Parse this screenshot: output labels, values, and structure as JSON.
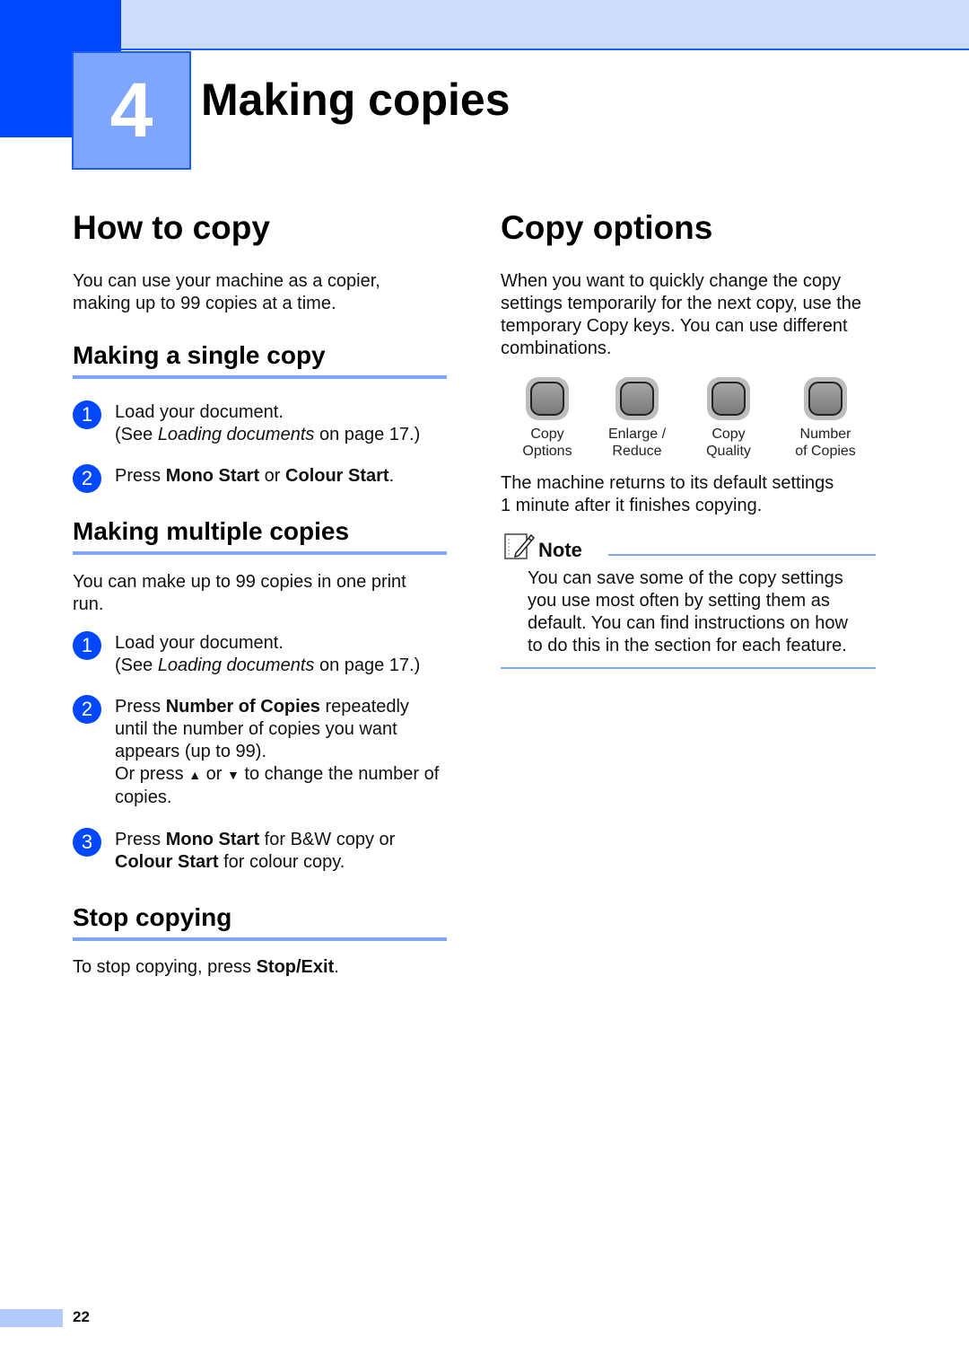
{
  "chapter": {
    "number": "4",
    "title": "Making copies"
  },
  "how_to_copy": {
    "heading": "How to copy",
    "intro": [
      "You can use your machine as a copier,",
      "making up to 99 copies at a time."
    ]
  },
  "single_copy": {
    "heading": "Making a single copy",
    "steps": [
      {
        "num": "1",
        "l1": "Load your document.",
        "l2_pre": "(See ",
        "l2_italic": "Loading documents",
        "l2_post": " on page 17.)"
      },
      {
        "num": "2",
        "pre": "Press ",
        "b1": "Mono Start",
        "mid": " or ",
        "b2": "Colour Start",
        "post": "."
      }
    ]
  },
  "multiple_copies": {
    "heading": "Making multiple copies",
    "intro": [
      "You can make up to 99 copies in one print",
      "run."
    ],
    "steps": [
      {
        "num": "1",
        "l1": "Load your document.",
        "l2_pre": "(See ",
        "l2_italic": "Loading documents",
        "l2_post": " on page 17.)"
      },
      {
        "num": "2",
        "pre": "Press ",
        "b1": "Number of Copies",
        "post": " repeatedly",
        "l2": "until the number of copies you want",
        "l3": "appears (up to 99).",
        "l4_pre": "Or press ",
        "up": "▲",
        "l4_mid": " or ",
        "down": "▼",
        "l4_post": " to change the number of",
        "l5": "copies."
      },
      {
        "num": "3",
        "pre": "Press ",
        "b1": "Mono Start",
        "post": " for B&W copy or",
        "b2": "Colour Start",
        "post2": " for colour copy."
      }
    ]
  },
  "stop_copying": {
    "heading": "Stop copying",
    "pre": "To stop copying, press ",
    "bold": "Stop/Exit",
    "post": "."
  },
  "copy_options": {
    "heading": "Copy options",
    "intro": [
      "When you want to quickly change the copy",
      "settings temporarily for the next copy, use the",
      "temporary Copy keys. You can use different",
      "combinations."
    ],
    "keys": [
      {
        "l1": "Copy",
        "l2": "Options"
      },
      {
        "l1": "Enlarge /",
        "l2": "Reduce"
      },
      {
        "l1": "Copy",
        "l2": "Quality"
      },
      {
        "l1": "Number",
        "l2": "of Copies"
      }
    ],
    "after": [
      "The machine returns to its default settings",
      "1 minute after it finishes copying."
    ]
  },
  "note": {
    "title": "Note",
    "lines": [
      "You can save some of the copy settings",
      "you use most often by setting them as",
      "default. You can find instructions on how",
      "to do this in the section for each feature."
    ]
  },
  "footer": {
    "page": "22"
  }
}
